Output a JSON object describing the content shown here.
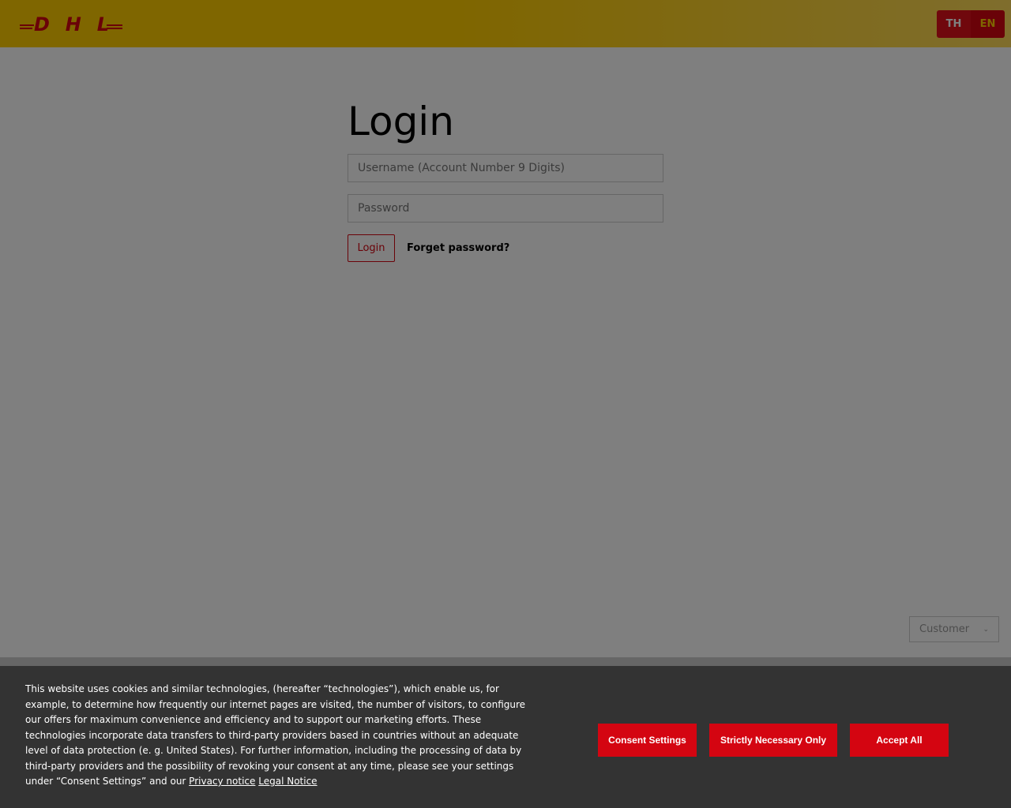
{
  "header": {
    "logo": "DHL",
    "lang": [
      "TH",
      "EN"
    ]
  },
  "login": {
    "title": "Login",
    "username_placeholder": "Username (Account Number 9 Digits)",
    "password_placeholder": "Password",
    "login_button": "Login",
    "forgot": "Forget password?"
  },
  "role_select": {
    "value": "Customer"
  },
  "cookie": {
    "text": "This website uses cookies and similar technologies, (hereafter “technologies”), which enable us, for example, to determine how frequently our internet pages are visited, the number of visitors, to configure our offers for maximum convenience and efficiency and to support our marketing efforts. These technologies incorporate data transfers to third-party providers based in countries without an adequate level of data protection (e. g. United States). For further information, including the processing of data by third-party providers and the possibility of revoking your consent at any time, please see your settings under “Consent Settings” and our ",
    "privacy": "Privacy notice",
    "legal": "Legal Notice",
    "buttons": [
      "Consent Settings",
      "Strictly Necessary Only",
      "Accept All"
    ]
  }
}
